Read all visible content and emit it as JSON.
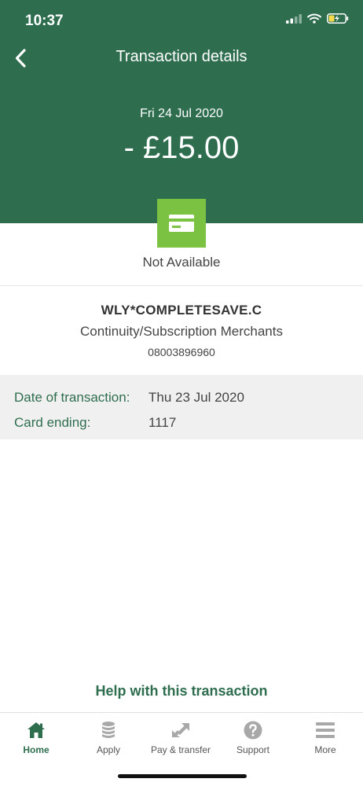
{
  "status_bar": {
    "time": "10:37"
  },
  "header": {
    "title": "Transaction details",
    "date": "Fri 24 Jul 2020",
    "amount": "- £15.00"
  },
  "card": {
    "status": "Not Available"
  },
  "merchant": {
    "name": "WLY*COMPLETESAVE.C",
    "category": "Continuity/Subscription Merchants",
    "phone": "08003896960"
  },
  "details": [
    {
      "label": "Date of transaction:",
      "value": "Thu 23 Jul 2020"
    },
    {
      "label": "Card ending:",
      "value": "1117"
    }
  ],
  "help_link": "Help with this transaction",
  "tabs": [
    {
      "label": "Home",
      "icon": "home-icon",
      "active": true
    },
    {
      "label": "Apply",
      "icon": "coin-stack-icon",
      "active": false
    },
    {
      "label": "Pay & transfer",
      "icon": "transfer-arrows-icon",
      "active": false
    },
    {
      "label": "Support",
      "icon": "help-circle-icon",
      "active": false
    },
    {
      "label": "More",
      "icon": "menu-icon",
      "active": false
    }
  ],
  "colors": {
    "brand_green": "#2e6e4f",
    "card_green": "#7cc242",
    "panel_grey": "#f0f0f0"
  }
}
